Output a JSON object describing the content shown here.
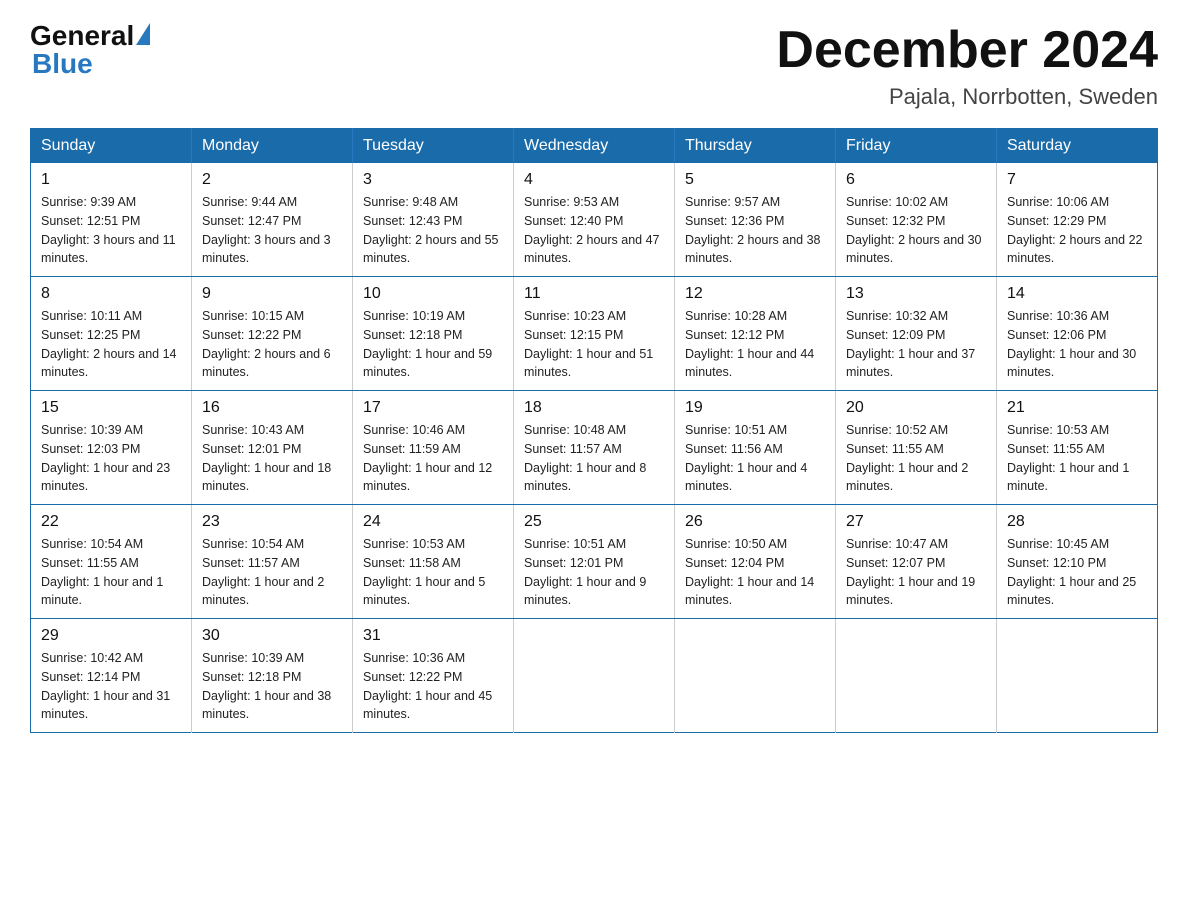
{
  "header": {
    "logo_general": "General",
    "logo_blue": "Blue",
    "month_title": "December 2024",
    "location": "Pajala, Norrbotten, Sweden"
  },
  "calendar": {
    "days_of_week": [
      "Sunday",
      "Monday",
      "Tuesday",
      "Wednesday",
      "Thursday",
      "Friday",
      "Saturday"
    ],
    "weeks": [
      [
        {
          "day": "1",
          "sunrise": "Sunrise: 9:39 AM",
          "sunset": "Sunset: 12:51 PM",
          "daylight": "Daylight: 3 hours and 11 minutes."
        },
        {
          "day": "2",
          "sunrise": "Sunrise: 9:44 AM",
          "sunset": "Sunset: 12:47 PM",
          "daylight": "Daylight: 3 hours and 3 minutes."
        },
        {
          "day": "3",
          "sunrise": "Sunrise: 9:48 AM",
          "sunset": "Sunset: 12:43 PM",
          "daylight": "Daylight: 2 hours and 55 minutes."
        },
        {
          "day": "4",
          "sunrise": "Sunrise: 9:53 AM",
          "sunset": "Sunset: 12:40 PM",
          "daylight": "Daylight: 2 hours and 47 minutes."
        },
        {
          "day": "5",
          "sunrise": "Sunrise: 9:57 AM",
          "sunset": "Sunset: 12:36 PM",
          "daylight": "Daylight: 2 hours and 38 minutes."
        },
        {
          "day": "6",
          "sunrise": "Sunrise: 10:02 AM",
          "sunset": "Sunset: 12:32 PM",
          "daylight": "Daylight: 2 hours and 30 minutes."
        },
        {
          "day": "7",
          "sunrise": "Sunrise: 10:06 AM",
          "sunset": "Sunset: 12:29 PM",
          "daylight": "Daylight: 2 hours and 22 minutes."
        }
      ],
      [
        {
          "day": "8",
          "sunrise": "Sunrise: 10:11 AM",
          "sunset": "Sunset: 12:25 PM",
          "daylight": "Daylight: 2 hours and 14 minutes."
        },
        {
          "day": "9",
          "sunrise": "Sunrise: 10:15 AM",
          "sunset": "Sunset: 12:22 PM",
          "daylight": "Daylight: 2 hours and 6 minutes."
        },
        {
          "day": "10",
          "sunrise": "Sunrise: 10:19 AM",
          "sunset": "Sunset: 12:18 PM",
          "daylight": "Daylight: 1 hour and 59 minutes."
        },
        {
          "day": "11",
          "sunrise": "Sunrise: 10:23 AM",
          "sunset": "Sunset: 12:15 PM",
          "daylight": "Daylight: 1 hour and 51 minutes."
        },
        {
          "day": "12",
          "sunrise": "Sunrise: 10:28 AM",
          "sunset": "Sunset: 12:12 PM",
          "daylight": "Daylight: 1 hour and 44 minutes."
        },
        {
          "day": "13",
          "sunrise": "Sunrise: 10:32 AM",
          "sunset": "Sunset: 12:09 PM",
          "daylight": "Daylight: 1 hour and 37 minutes."
        },
        {
          "day": "14",
          "sunrise": "Sunrise: 10:36 AM",
          "sunset": "Sunset: 12:06 PM",
          "daylight": "Daylight: 1 hour and 30 minutes."
        }
      ],
      [
        {
          "day": "15",
          "sunrise": "Sunrise: 10:39 AM",
          "sunset": "Sunset: 12:03 PM",
          "daylight": "Daylight: 1 hour and 23 minutes."
        },
        {
          "day": "16",
          "sunrise": "Sunrise: 10:43 AM",
          "sunset": "Sunset: 12:01 PM",
          "daylight": "Daylight: 1 hour and 18 minutes."
        },
        {
          "day": "17",
          "sunrise": "Sunrise: 10:46 AM",
          "sunset": "Sunset: 11:59 AM",
          "daylight": "Daylight: 1 hour and 12 minutes."
        },
        {
          "day": "18",
          "sunrise": "Sunrise: 10:48 AM",
          "sunset": "Sunset: 11:57 AM",
          "daylight": "Daylight: 1 hour and 8 minutes."
        },
        {
          "day": "19",
          "sunrise": "Sunrise: 10:51 AM",
          "sunset": "Sunset: 11:56 AM",
          "daylight": "Daylight: 1 hour and 4 minutes."
        },
        {
          "day": "20",
          "sunrise": "Sunrise: 10:52 AM",
          "sunset": "Sunset: 11:55 AM",
          "daylight": "Daylight: 1 hour and 2 minutes."
        },
        {
          "day": "21",
          "sunrise": "Sunrise: 10:53 AM",
          "sunset": "Sunset: 11:55 AM",
          "daylight": "Daylight: 1 hour and 1 minute."
        }
      ],
      [
        {
          "day": "22",
          "sunrise": "Sunrise: 10:54 AM",
          "sunset": "Sunset: 11:55 AM",
          "daylight": "Daylight: 1 hour and 1 minute."
        },
        {
          "day": "23",
          "sunrise": "Sunrise: 10:54 AM",
          "sunset": "Sunset: 11:57 AM",
          "daylight": "Daylight: 1 hour and 2 minutes."
        },
        {
          "day": "24",
          "sunrise": "Sunrise: 10:53 AM",
          "sunset": "Sunset: 11:58 AM",
          "daylight": "Daylight: 1 hour and 5 minutes."
        },
        {
          "day": "25",
          "sunrise": "Sunrise: 10:51 AM",
          "sunset": "Sunset: 12:01 PM",
          "daylight": "Daylight: 1 hour and 9 minutes."
        },
        {
          "day": "26",
          "sunrise": "Sunrise: 10:50 AM",
          "sunset": "Sunset: 12:04 PM",
          "daylight": "Daylight: 1 hour and 14 minutes."
        },
        {
          "day": "27",
          "sunrise": "Sunrise: 10:47 AM",
          "sunset": "Sunset: 12:07 PM",
          "daylight": "Daylight: 1 hour and 19 minutes."
        },
        {
          "day": "28",
          "sunrise": "Sunrise: 10:45 AM",
          "sunset": "Sunset: 12:10 PM",
          "daylight": "Daylight: 1 hour and 25 minutes."
        }
      ],
      [
        {
          "day": "29",
          "sunrise": "Sunrise: 10:42 AM",
          "sunset": "Sunset: 12:14 PM",
          "daylight": "Daylight: 1 hour and 31 minutes."
        },
        {
          "day": "30",
          "sunrise": "Sunrise: 10:39 AM",
          "sunset": "Sunset: 12:18 PM",
          "daylight": "Daylight: 1 hour and 38 minutes."
        },
        {
          "day": "31",
          "sunrise": "Sunrise: 10:36 AM",
          "sunset": "Sunset: 12:22 PM",
          "daylight": "Daylight: 1 hour and 45 minutes."
        },
        null,
        null,
        null,
        null
      ]
    ]
  }
}
